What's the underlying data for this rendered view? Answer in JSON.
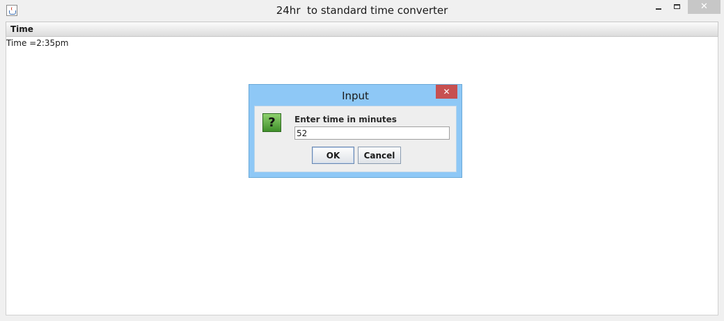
{
  "window": {
    "title": "24hr  to standard time converter",
    "close_glyph": "✕"
  },
  "menubar": {
    "items": [
      {
        "label": "Time"
      }
    ]
  },
  "content": {
    "time_text": "Time =2:35pm"
  },
  "dialog": {
    "title": "Input",
    "close_glyph": "✕",
    "icon": "question-icon",
    "icon_glyph": "?",
    "prompt": "Enter time in minutes",
    "input_value": "52",
    "ok_label": "OK",
    "cancel_label": "Cancel"
  },
  "colors": {
    "dialog_frame": "#8ec8f6",
    "close_red": "#c75050"
  }
}
